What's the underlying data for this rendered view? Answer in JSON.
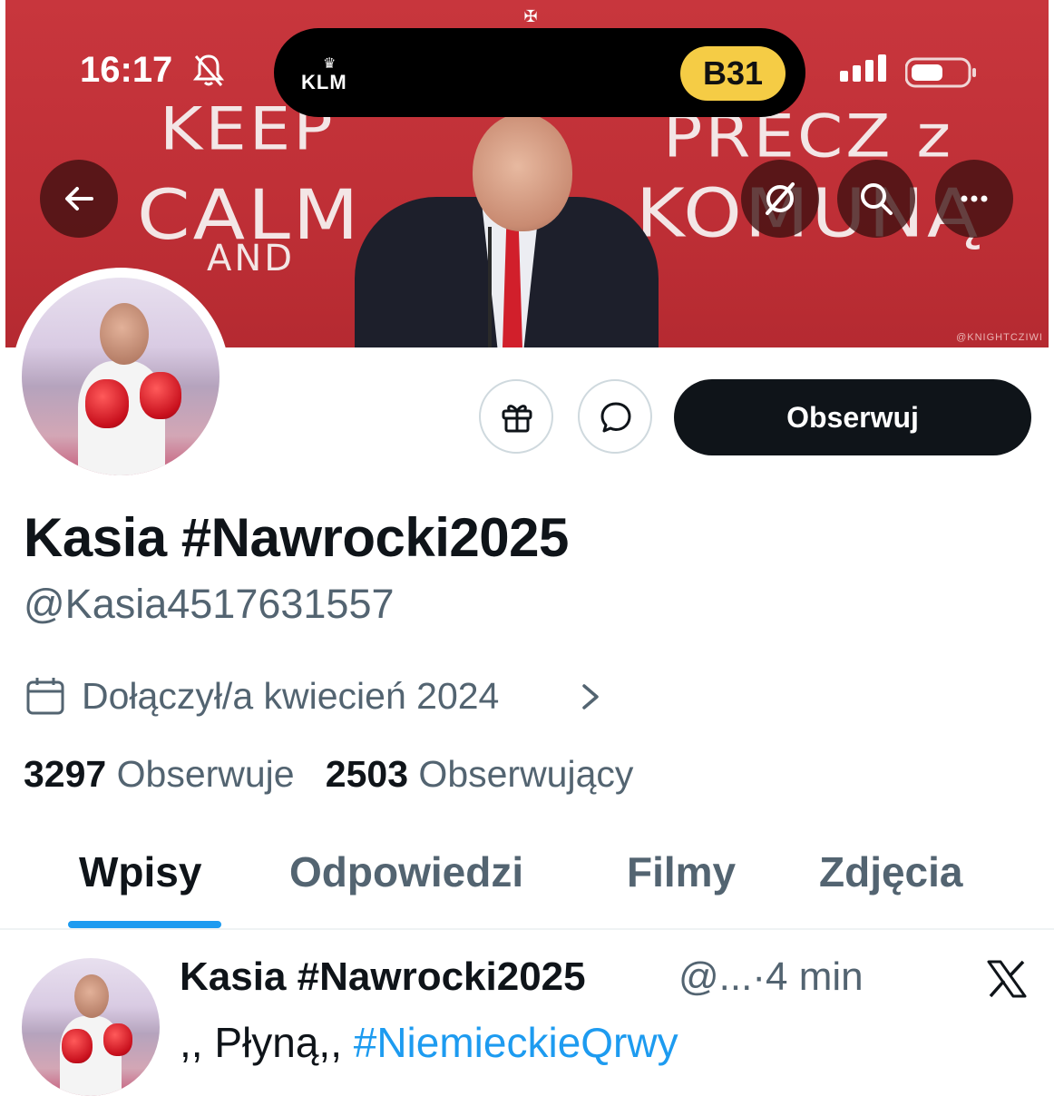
{
  "status_bar": {
    "time": "16:17",
    "airline": "KLM",
    "gate": "B31"
  },
  "banner": {
    "line_keep": "KEEP",
    "line_calm": "CALM",
    "line_and": "AND",
    "line_precz": "PRECZ z",
    "line_komuna": "KOMUNĄ",
    "credit": "@KNIGHTCZIWI"
  },
  "actions": {
    "follow_label": "Obserwuj"
  },
  "profile": {
    "display_name": "Kasia #Nawrocki2025",
    "handle": "@Kasia4517631557",
    "joined": "Dołączył/a kwiecień 2024",
    "following_count": "3297",
    "following_label": "Obserwuje",
    "followers_count": "2503",
    "followers_label": "Obserwujący"
  },
  "tabs": [
    {
      "label": "Wpisy",
      "active": true
    },
    {
      "label": "Odpowiedzi",
      "active": false
    },
    {
      "label": "Filmy",
      "active": false
    },
    {
      "label": "Zdjęcia",
      "active": false
    }
  ],
  "post": {
    "author": "Kasia #Nawrocki2025",
    "handle_truncated": "@...",
    "separator": "·",
    "time": "4 min",
    "text_prefix": ",, Płyną,,",
    "hashtag": "#NiemieckieQrwy"
  },
  "colors": {
    "banner_red": "#c8363d",
    "accent_blue": "#1d9bf0",
    "gate_yellow": "#f5cc45",
    "follow_button": "#0f1419"
  },
  "icons": [
    "back-arrow-icon",
    "translate-icon",
    "search-icon",
    "more-icon",
    "gift-icon",
    "message-icon",
    "calendar-icon",
    "chevron-right-icon",
    "x-logo-icon",
    "bell-off-icon",
    "signal-icon",
    "battery-icon"
  ]
}
